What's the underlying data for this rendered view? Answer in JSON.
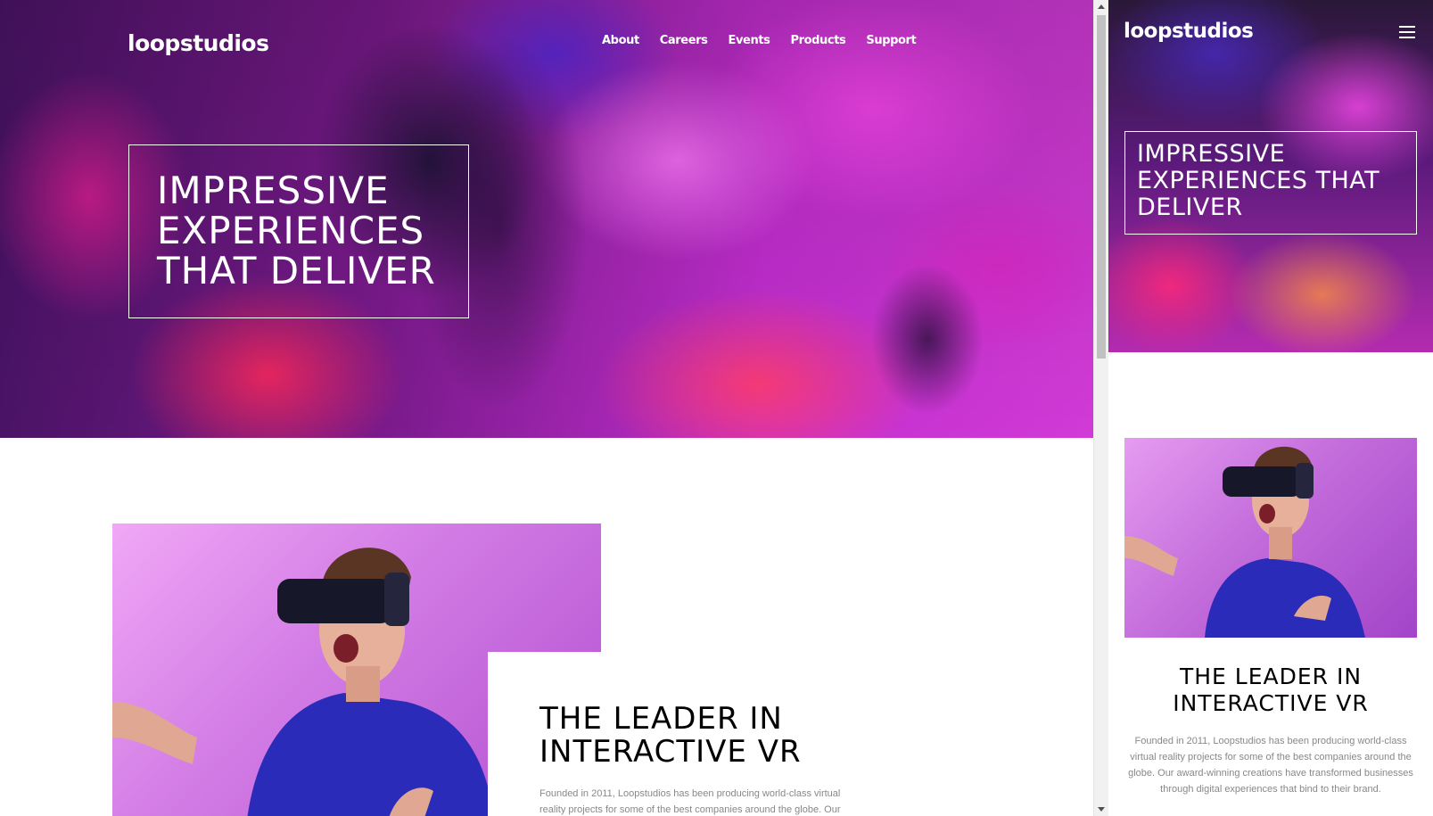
{
  "brand": {
    "logo": "loopstudios"
  },
  "nav": {
    "items": [
      {
        "label": "About"
      },
      {
        "label": "Careers"
      },
      {
        "label": "Events"
      },
      {
        "label": "Products"
      },
      {
        "label": "Support"
      }
    ]
  },
  "hero": {
    "title": "IMPRESSIVE EXPERIENCES THAT DELIVER"
  },
  "intro": {
    "title": "THE LEADER IN INTERACTIVE VR",
    "body": "Founded in 2011, Loopstudios has been producing world-class virtual reality projects for some of the best companies around the globe. Our award-winning creations have transformed businesses through digital experiences that bind to their brand."
  },
  "colors": {
    "hero_accent": "#c22ecf",
    "photo_bg": "#d47ee6",
    "text_dark": "#000000",
    "text_muted": "#888888"
  },
  "icons": {
    "menu": "hamburger-icon"
  }
}
